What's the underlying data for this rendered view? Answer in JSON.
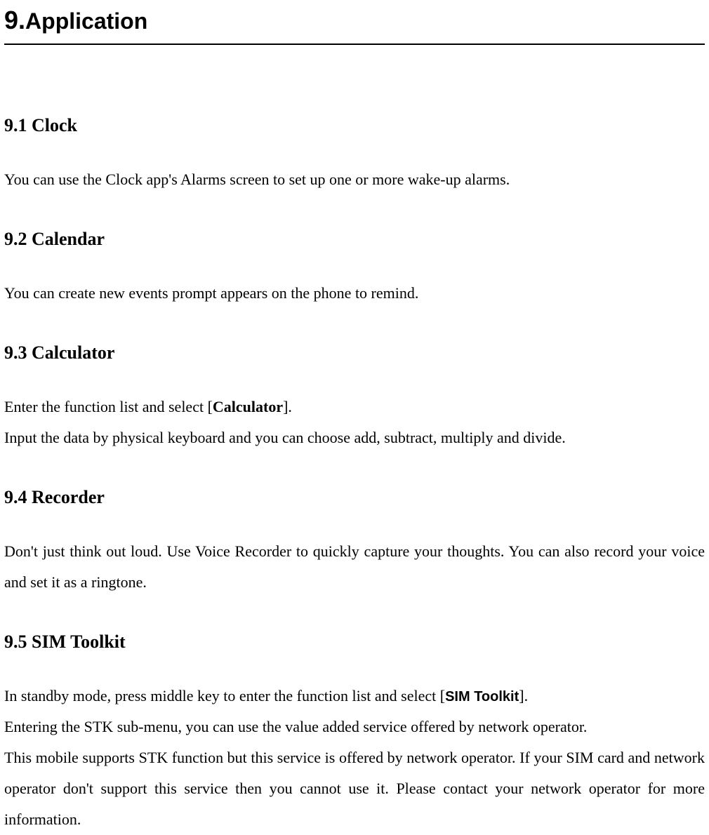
{
  "chapter": {
    "number": "9.",
    "title": "Application"
  },
  "sections": [
    {
      "heading": "9.1    Clock",
      "paragraphs": [
        "You can use the Clock app's Alarms screen to set up one or more wake-up alarms."
      ]
    },
    {
      "heading": "9.2    Calendar",
      "paragraphs": [
        "You can create new events prompt appears on the phone to remind."
      ]
    },
    {
      "heading": "9.3    Calculator",
      "paragraphs_calc": {
        "p1_pre": "Enter the function list and select [",
        "p1_bold": "Calculator",
        "p1_post": "].",
        "p2": "Input the data by physical keyboard and you can choose add, subtract, multiply and divide."
      }
    },
    {
      "heading": "9.4    Recorder",
      "paragraphs": [
        "Don't just think out loud. Use Voice Recorder to quickly capture your thoughts. You can also record your voice and set it as a ringtone."
      ]
    },
    {
      "heading": "9.5    SIM Toolkit",
      "paragraphs_sim": {
        "p1_pre": "In standby mode, press middle key to enter the function list and select [",
        "p1_bold": "SIM Toolkit",
        "p1_post": "].",
        "p2": "Entering the STK sub-menu, you can use the value added service offered by network operator.",
        "p3": "This mobile supports STK function but this service is offered by network operator. If your SIM card and network operator don't support this service then you cannot use it. Please contact your network operator for more information."
      }
    }
  ]
}
